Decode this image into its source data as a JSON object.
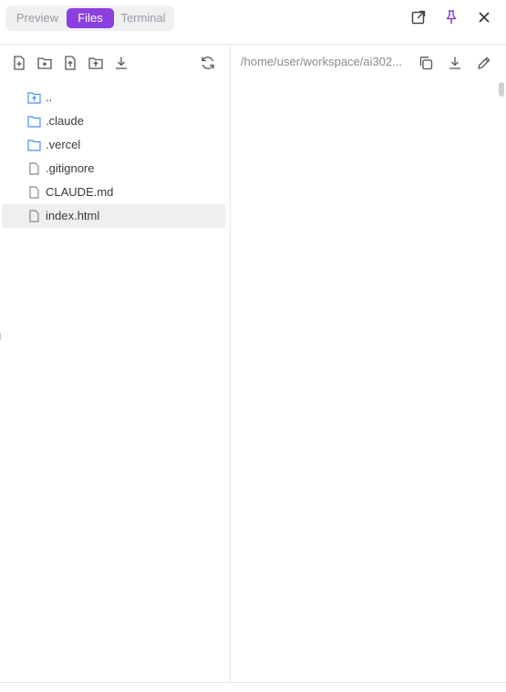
{
  "tabs": [
    {
      "label": "Preview"
    },
    {
      "label": "Files"
    },
    {
      "label": "Terminal"
    }
  ],
  "icons": {
    "open_external": "external-link-icon",
    "pin": "pin-icon",
    "close": "close-icon",
    "pin_color": "#8b3fe0",
    "accent": "#8b3fe0",
    "folder_color": "#4a8ff0"
  },
  "file_toolbar": {
    "buttons": [
      "new-file-icon",
      "new-folder-icon",
      "upload-file-icon",
      "upload-folder-icon",
      "download-icon",
      "refresh-icon"
    ]
  },
  "tree": [
    {
      "name": "..",
      "type": "parent"
    },
    {
      "name": ".claude",
      "type": "folder"
    },
    {
      "name": ".vercel",
      "type": "folder"
    },
    {
      "name": ".gitignore",
      "type": "file"
    },
    {
      "name": "CLAUDE.md",
      "type": "file"
    },
    {
      "name": "index.html",
      "type": "file",
      "selected": true
    }
  ],
  "editor": {
    "path": "/home/user/workspace/ai302..."
  }
}
